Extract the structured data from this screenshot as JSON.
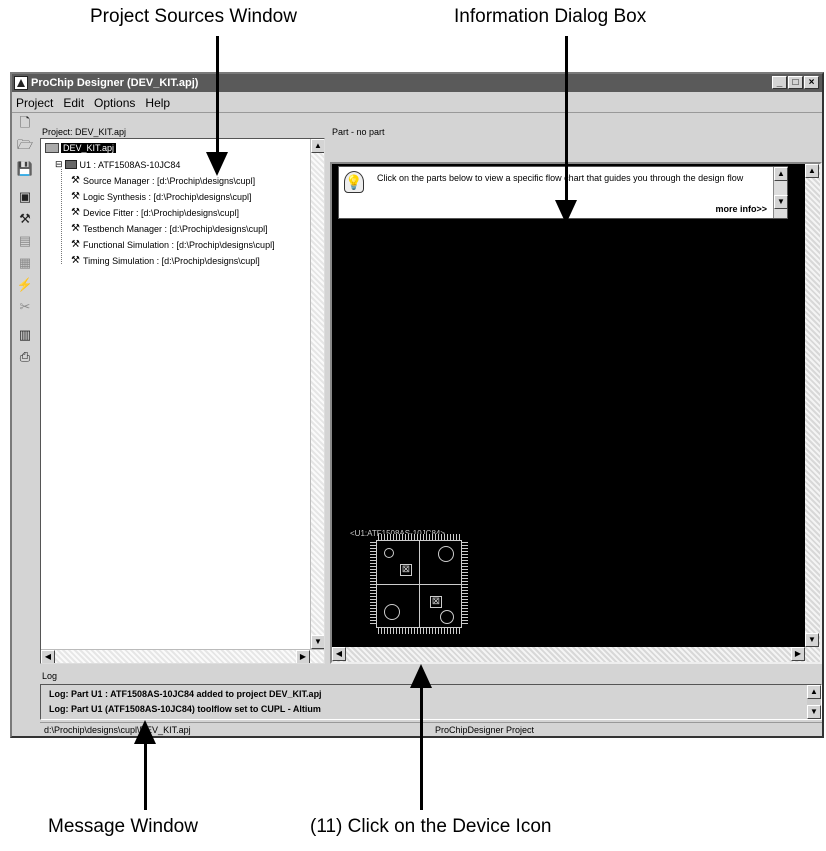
{
  "callouts": {
    "project_sources": "Project Sources Window",
    "info_dialog": "Information Dialog Box",
    "message_window": "Message Window",
    "device_icon": "(11) Click on the Device Icon"
  },
  "window": {
    "title": "ProChip Designer (DEV_KIT.apj)",
    "buttons": [
      "_",
      "□",
      "×"
    ]
  },
  "menu": [
    "Project",
    "Edit",
    "Options",
    "Help"
  ],
  "toolbar": {
    "icons": [
      "new-file-icon",
      "open-folder-icon",
      "save-icon",
      "chip-icon",
      "tools-icon",
      "document-icon",
      "notepad-icon",
      "lightning-icon",
      "scissors-icon",
      "gallery-icon",
      "print-preview-icon"
    ]
  },
  "project_panel": {
    "label": "Project: DEV_KIT.apj",
    "root": "DEV_KIT.apj",
    "part": "U1 : ATF1508AS-10JC84",
    "items": [
      "Source Manager :  [d:\\Prochip\\designs\\cupl]",
      "Logic Synthesis :  [d:\\Prochip\\designs\\cupl]",
      "Device Fitter :  [d:\\Prochip\\designs\\cupl]",
      "Testbench Manager :  [d:\\Prochip\\designs\\cupl]",
      "Functional Simulation :  [d:\\Prochip\\designs\\cupl]",
      "Timing Simulation :  [d:\\Prochip\\designs\\cupl]"
    ]
  },
  "part_panel": {
    "label": "Part - no part",
    "info_text": "Click on the parts below to view a specific flow chart that guides you through the design flow",
    "more_info": "more info>>",
    "chip_label": "<U1:ATF1508AS-10JC84>"
  },
  "log": {
    "label": "Log",
    "lines": [
      "Log: Part U1 : ATF1508AS-10JC84 added to project DEV_KIT.apj",
      "Log: Part U1 (ATF1508AS-10JC84)  toolflow set to CUPL - Altium"
    ]
  },
  "status": {
    "path": "d:\\Prochip\\designs\\cupl\\DEV_KIT.apj",
    "project_type": "ProChipDesigner Project"
  }
}
